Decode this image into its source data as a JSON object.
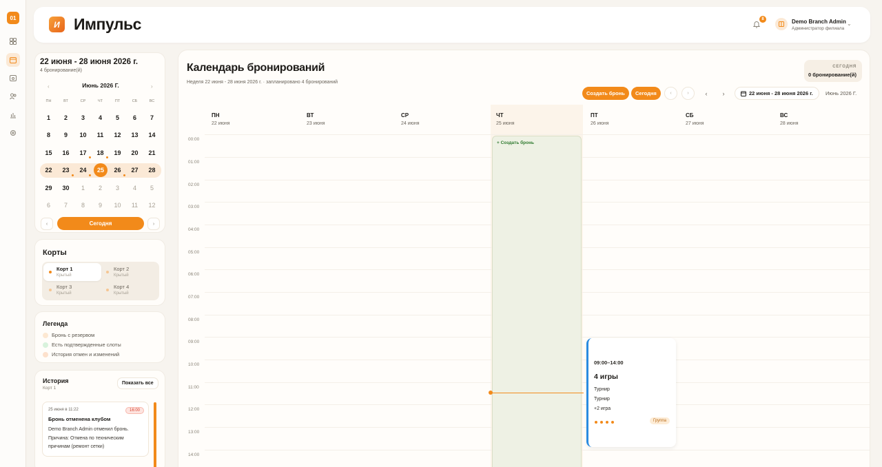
{
  "app": {
    "brand": "Импульс",
    "logo_text": "И",
    "rail_logo": "01"
  },
  "user": {
    "name": "Demo Branch Admin",
    "role": "Администратор филиала",
    "notifications": "8"
  },
  "mini_calendar": {
    "range": "22 июня - 28 июня 2026 г.",
    "count": "4 бронирование(й)",
    "month": "Июнь 2026 Г.",
    "prev": "‹",
    "next": "›",
    "weekdays": [
      "ПН",
      "ВТ",
      "СР",
      "ЧТ",
      "ПТ",
      "СБ",
      "ВС"
    ],
    "weeks": [
      [
        "1",
        "2",
        "3",
        "4",
        "5",
        "6",
        "7"
      ],
      [
        "8",
        "9",
        "10",
        "11",
        "12",
        "13",
        "14"
      ],
      [
        "15",
        "16",
        "17",
        "18",
        "19",
        "20",
        "21"
      ],
      [
        "22",
        "23",
        "24",
        "25",
        "26",
        "27",
        "28"
      ],
      [
        "29",
        "30",
        "1",
        "2",
        "3",
        "4",
        "5"
      ],
      [
        "6",
        "7",
        "8",
        "9",
        "10",
        "11",
        "12"
      ]
    ],
    "today_label": "Сегодня",
    "page_prev": "‹",
    "page_next": "›"
  },
  "courts": {
    "title": "Корты",
    "items": [
      {
        "name": "Корт 1",
        "type": "Крытый"
      },
      {
        "name": "Корт 2",
        "type": "Крытый"
      },
      {
        "name": "Корт 3",
        "type": "Крытый"
      },
      {
        "name": "Корт 4",
        "type": "Крытый"
      }
    ]
  },
  "legend": {
    "title": "Легенда",
    "items": [
      {
        "label": "Бронь с резервом",
        "color": "#fde8d2"
      },
      {
        "label": "Есть подтвержденные слоты",
        "color": "#d8f2dc"
      },
      {
        "label": "История отмен и изменений",
        "color": "#fde1cc"
      }
    ]
  },
  "history": {
    "title": "История",
    "subtitle": "Корт 1",
    "show_all": "Показать все",
    "entry": {
      "date": "25 июня в 11:22",
      "time": "16:00",
      "title": "Бронь отменена клубом",
      "body": "Demo Branch Admin отменил бронь. Причина: Отмена по техническим причинам (ремонт сетки)"
    }
  },
  "main": {
    "title": "Календарь бронирований",
    "subtitle": "Неделя 22 июня - 28 июня 2026 г. · запланировано 4 бронирований",
    "today_box_label": "СЕГОДНЯ",
    "today_box_value": "0 бронирование(й)",
    "create_btn": "Создать бронь",
    "today_btn": "Сегодня",
    "range_btn": "22 июня - 28 июня 2026 г.",
    "month_label": "Июнь 2026 Г.",
    "days": [
      {
        "name": "ПН",
        "date": "22 июня"
      },
      {
        "name": "ВТ",
        "date": "23 июня"
      },
      {
        "name": "СР",
        "date": "24 июня"
      },
      {
        "name": "ЧТ",
        "date": "25 июня"
      },
      {
        "name": "ПТ",
        "date": "26 июня"
      },
      {
        "name": "СБ",
        "date": "27 июня"
      },
      {
        "name": "ВС",
        "date": "28 июня"
      }
    ],
    "hours": [
      "00:00",
      "01:00",
      "02:00",
      "03:00",
      "04:00",
      "05:00",
      "06:00",
      "07:00",
      "08:00",
      "09:00",
      "10:00",
      "11:00",
      "12:00",
      "13:00",
      "14:00"
    ],
    "create_slot": "+ Создать бронь",
    "event": {
      "time": "09:00–14:00",
      "title": "4 игры",
      "items": [
        "Турнир",
        "Турнир",
        "+2 игра"
      ],
      "tag": "Группа"
    }
  }
}
